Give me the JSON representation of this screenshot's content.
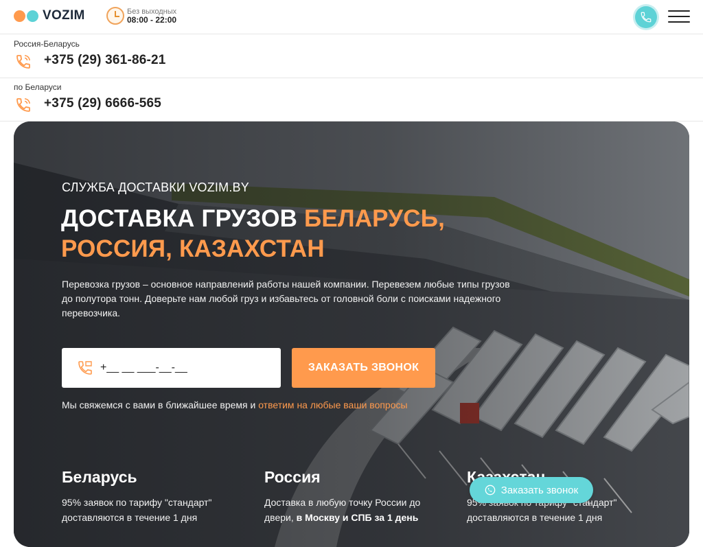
{
  "brand": {
    "name": "VOZIM",
    "dot_colors": [
      "#ff9a4d",
      "#5dd2d6"
    ]
  },
  "header": {
    "hours_label": "Без выходных",
    "hours_value": "08:00 - 22:00"
  },
  "phones": [
    {
      "region": "Россия-Беларусь",
      "number": "+375 (29) 361-86-21"
    },
    {
      "region": "по Беларуси",
      "number": "+375 (29) 6666-565"
    }
  ],
  "hero": {
    "eyebrow": "СЛУЖБА ДОСТАВКИ VOZIM.BY",
    "headline_white": "ДОСТАВКА ГРУЗОВ ",
    "headline_orange": "БЕЛАРУСЬ, РОССИЯ, КАЗАХСТАН",
    "description": "Перевозка грузов – основное направлений работы нашей компании. Перевезем любые типы грузов до полутора тонн. Доверьте нам любой груз и избавьтесь от головной боли с поисками надежного перевозчика.",
    "phone_placeholder": "+__ __ ___-__-__",
    "cta_label": "ЗАКАЗАТЬ ЗВОНОК",
    "note_prefix": "Мы свяжемся с вами в ближайшее время и ",
    "note_accent": "ответим на любые ваши вопросы"
  },
  "regions": [
    {
      "title": "Беларусь",
      "text_plain": "95% заявок по тарифу \"стандарт\" доставляются в течение 1 дня",
      "text_bold": ""
    },
    {
      "title": "Россия",
      "text_plain": "Доставка в любую точку России до двери, ",
      "text_bold": "в Москву и СПБ за 1 день"
    },
    {
      "title": "Казахстан",
      "text_plain": "95% заявок по тарифу \"стандарт\" доставляются в течение 1 дня",
      "text_bold": ""
    }
  ],
  "floating_callback": {
    "label": "Заказать звонок"
  },
  "colors": {
    "accent_orange": "#ff9a4d",
    "accent_cyan": "#5dd2d6"
  },
  "icons": [
    "clock-icon",
    "phone-call-icon",
    "menu-icon",
    "phone-icon",
    "phone-input-icon",
    "callback-icon"
  ]
}
